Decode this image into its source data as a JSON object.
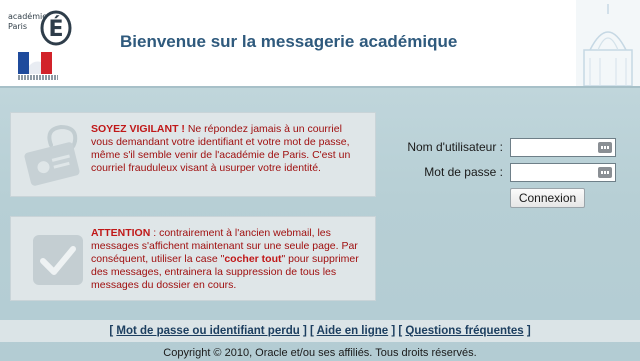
{
  "header": {
    "logo_line1": "académie",
    "logo_line2": "Paris",
    "title": "Bienvenue sur la messagerie académique"
  },
  "warning_panel": {
    "heading": "SOYEZ VIGILANT !",
    "body": " Ne répondez jamais à un courriel vous demandant votre identifiant et votre mot de passe, même s'il semble venir de l'académie de Paris. C'est un courriel frauduleux visant à usurper votre identité.",
    "icon": "id-card-hook-icon"
  },
  "attention_panel": {
    "heading": "ATTENTION",
    "body_before": " : contrairement à l'ancien webmail, les messages s'affichent maintenant sur une seule page. Par conséquent, utiliser la case \"",
    "highlight": "cocher tout",
    "body_after": "\" pour supprimer des messages, entrainera la suppression de tous les messages du dossier en cours.",
    "icon": "checkbox-checked-icon"
  },
  "login": {
    "username_label": "Nom d'utilisateur :",
    "username_value": "",
    "password_label": "Mot de passe :",
    "password_value": "",
    "submit_label": "Connexion"
  },
  "footer": {
    "open_bracket": "[ ",
    "link_forgot": "Mot de passe ou identifiant perdu",
    "separator1": " ] [ ",
    "link_help": "Aide en ligne",
    "separator2": " ] [ ",
    "link_faq": "Questions fréquentes",
    "close_bracket": " ]",
    "copyright": "Copyright © 2010, Oracle et/ou ses affiliés. Tous droits réservés."
  },
  "colors": {
    "title": "#2f5a7d",
    "warning_text": "#a01010",
    "page_background": "#b9d0d6",
    "panel_background": "#dfe6e8"
  }
}
